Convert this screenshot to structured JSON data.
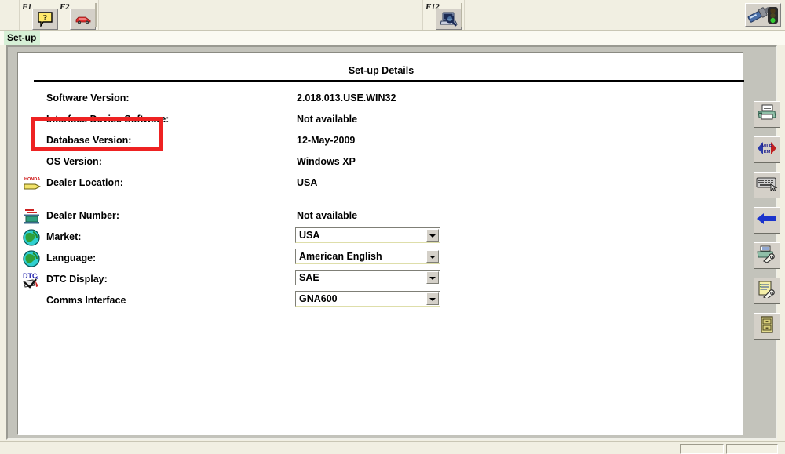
{
  "toolbar": {
    "keys": [
      {
        "key": "F1",
        "icon": "help-question-icon",
        "name": "help"
      },
      {
        "key": "F2",
        "icon": "car-icon",
        "name": "vehicle"
      },
      {
        "key": "F12",
        "icon": "computer-search-icon",
        "name": "system-info"
      }
    ],
    "connector": {
      "icon": "diagnostic-connector-icon",
      "status_icon": "traffic-light-green-icon",
      "status_color": "#33cc33"
    }
  },
  "tab": {
    "label": "Set-up",
    "highlight_color": "#d6f0d6"
  },
  "main": {
    "title": "Set-up Details",
    "rows": [
      {
        "label": "Software Version:",
        "value": "2.018.013.USE.WIN32",
        "icon": null,
        "type": "text",
        "name": "software-version"
      },
      {
        "label": "Interface Device Software:",
        "value": "Not available",
        "icon": null,
        "type": "text",
        "name": "interface-device-software"
      },
      {
        "label": "Database Version:",
        "value": "12-May-2009",
        "icon": null,
        "type": "text",
        "name": "database-version"
      },
      {
        "label": "OS Version:",
        "value": "Windows XP",
        "icon": null,
        "type": "text",
        "name": "os-version"
      },
      {
        "label": "Dealer Location:",
        "value": "USA",
        "icon": "honda-dealer-location-icon",
        "type": "text",
        "name": "dealer-location"
      },
      {
        "label": "Dealer Number:",
        "value": "Not available",
        "icon": "dealer-building-icon",
        "type": "text",
        "name": "dealer-number"
      },
      {
        "label": "Market:",
        "value": "USA",
        "icon": "globe-icon",
        "type": "combo",
        "name": "market"
      },
      {
        "label": "Language:",
        "value": "American English",
        "icon": "globe-icon",
        "type": "combo",
        "name": "language"
      },
      {
        "label": "DTC Display:",
        "value": "SAE",
        "icon": "dtc-check-icon",
        "type": "combo",
        "name": "dtc-display"
      },
      {
        "label": "Comms Interface",
        "value": "GNA600",
        "icon": null,
        "type": "combo",
        "name": "comms-interface"
      }
    ]
  },
  "annotation": {
    "target": "Software Version:",
    "color": "#ee2222"
  },
  "side_toolbar": {
    "buttons": [
      {
        "icon": "printer-icon",
        "name": "print"
      },
      {
        "icon": "mile-km-toggle-icon",
        "name": "units-toggle",
        "label_top": "MILE",
        "label_bottom": "KM"
      },
      {
        "icon": "keyboard-icon",
        "name": "keyboard-input"
      },
      {
        "icon": "blue-back-arrow-icon",
        "name": "back"
      },
      {
        "icon": "printer-settings-icon",
        "name": "printer-settings"
      },
      {
        "icon": "notepad-settings-icon",
        "name": "report-settings"
      },
      {
        "icon": "file-cabinet-icon",
        "name": "file-cabinet"
      }
    ]
  }
}
